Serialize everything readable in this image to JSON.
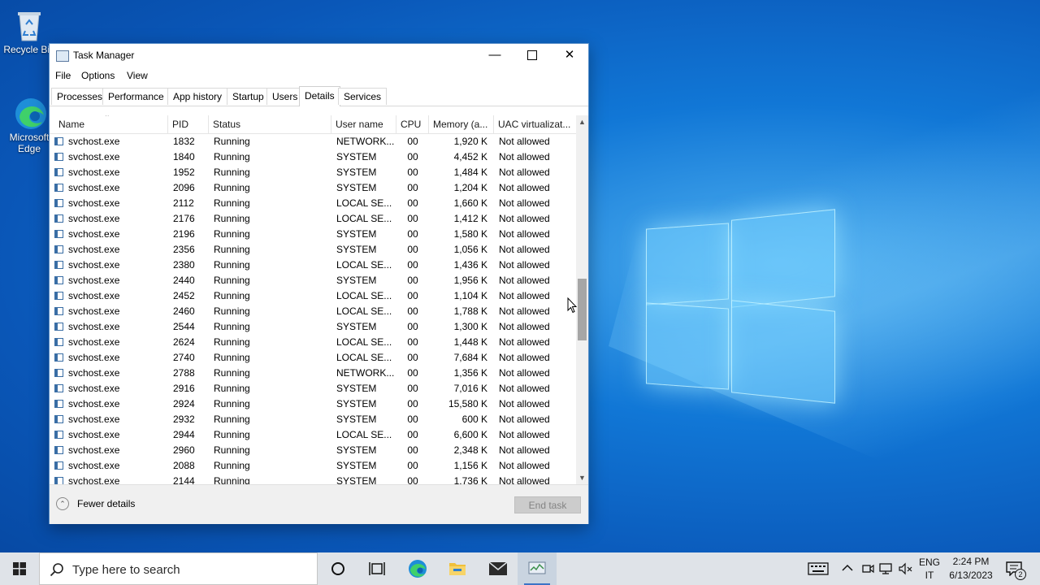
{
  "desktop": {
    "icons": [
      {
        "label": "Recycle Bin"
      },
      {
        "label": "Microsoft Edge"
      }
    ]
  },
  "window": {
    "title": "Task Manager",
    "menu": [
      "File",
      "Options",
      "View"
    ],
    "tabs": [
      {
        "label": "Processes",
        "active": false
      },
      {
        "label": "Performance",
        "active": false
      },
      {
        "label": "App history",
        "active": false
      },
      {
        "label": "Startup",
        "active": false
      },
      {
        "label": "Users",
        "active": false
      },
      {
        "label": "Details",
        "active": true
      },
      {
        "label": "Services",
        "active": false
      }
    ],
    "columns": [
      "Name",
      "PID",
      "Status",
      "User name",
      "CPU",
      "Memory (a...",
      "UAC virtualizat..."
    ],
    "rows": [
      [
        "svchost.exe",
        "1832",
        "Running",
        "NETWORK...",
        "00",
        "1,920 K",
        "Not allowed"
      ],
      [
        "svchost.exe",
        "1840",
        "Running",
        "SYSTEM",
        "00",
        "4,452 K",
        "Not allowed"
      ],
      [
        "svchost.exe",
        "1952",
        "Running",
        "SYSTEM",
        "00",
        "1,484 K",
        "Not allowed"
      ],
      [
        "svchost.exe",
        "2096",
        "Running",
        "SYSTEM",
        "00",
        "1,204 K",
        "Not allowed"
      ],
      [
        "svchost.exe",
        "2112",
        "Running",
        "LOCAL SE...",
        "00",
        "1,660 K",
        "Not allowed"
      ],
      [
        "svchost.exe",
        "2176",
        "Running",
        "LOCAL SE...",
        "00",
        "1,412 K",
        "Not allowed"
      ],
      [
        "svchost.exe",
        "2196",
        "Running",
        "SYSTEM",
        "00",
        "1,580 K",
        "Not allowed"
      ],
      [
        "svchost.exe",
        "2356",
        "Running",
        "SYSTEM",
        "00",
        "1,056 K",
        "Not allowed"
      ],
      [
        "svchost.exe",
        "2380",
        "Running",
        "LOCAL SE...",
        "00",
        "1,436 K",
        "Not allowed"
      ],
      [
        "svchost.exe",
        "2440",
        "Running",
        "SYSTEM",
        "00",
        "1,956 K",
        "Not allowed"
      ],
      [
        "svchost.exe",
        "2452",
        "Running",
        "LOCAL SE...",
        "00",
        "1,104 K",
        "Not allowed"
      ],
      [
        "svchost.exe",
        "2460",
        "Running",
        "LOCAL SE...",
        "00",
        "1,788 K",
        "Not allowed"
      ],
      [
        "svchost.exe",
        "2544",
        "Running",
        "SYSTEM",
        "00",
        "1,300 K",
        "Not allowed"
      ],
      [
        "svchost.exe",
        "2624",
        "Running",
        "LOCAL SE...",
        "00",
        "1,448 K",
        "Not allowed"
      ],
      [
        "svchost.exe",
        "2740",
        "Running",
        "LOCAL SE...",
        "00",
        "7,684 K",
        "Not allowed"
      ],
      [
        "svchost.exe",
        "2788",
        "Running",
        "NETWORK...",
        "00",
        "1,356 K",
        "Not allowed"
      ],
      [
        "svchost.exe",
        "2916",
        "Running",
        "SYSTEM",
        "00",
        "7,016 K",
        "Not allowed"
      ],
      [
        "svchost.exe",
        "2924",
        "Running",
        "SYSTEM",
        "00",
        "15,580 K",
        "Not allowed"
      ],
      [
        "svchost.exe",
        "2932",
        "Running",
        "SYSTEM",
        "00",
        "600 K",
        "Not allowed"
      ],
      [
        "svchost.exe",
        "2944",
        "Running",
        "LOCAL SE...",
        "00",
        "6,600 K",
        "Not allowed"
      ],
      [
        "svchost.exe",
        "2960",
        "Running",
        "SYSTEM",
        "00",
        "2,348 K",
        "Not allowed"
      ],
      [
        "svchost.exe",
        "2088",
        "Running",
        "SYSTEM",
        "00",
        "1,156 K",
        "Not allowed"
      ],
      [
        "svchost.exe",
        "2144",
        "Running",
        "SYSTEM",
        "00",
        "1,736 K",
        "Not allowed"
      ]
    ],
    "fewer_details": "Fewer details",
    "end_task": "End task"
  },
  "taskbar": {
    "search_placeholder": "Type here to search",
    "lang_top": "ENG",
    "lang_bottom": "IT",
    "time": "2:24 PM",
    "date": "6/13/2023",
    "notification_count": "2"
  },
  "colors": {
    "accent": "#3c74c6",
    "desktop": "#0a57b8",
    "taskbar": "#dfe3e8"
  }
}
